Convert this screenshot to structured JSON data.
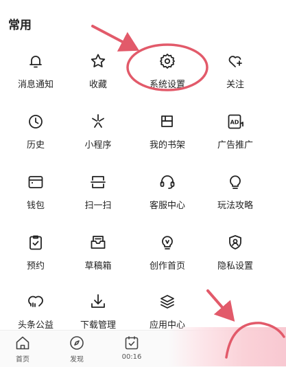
{
  "section": {
    "title": "常用"
  },
  "grid": {
    "rows": [
      [
        {
          "label": "消息通知",
          "icon": "bell-icon"
        },
        {
          "label": "收藏",
          "icon": "star-icon"
        },
        {
          "label": "系统设置",
          "icon": "gear-icon"
        },
        {
          "label": "关注",
          "icon": "heart-plus-icon"
        }
      ],
      [
        {
          "label": "历史",
          "icon": "clock-icon"
        },
        {
          "label": "小程序",
          "icon": "asterisk-icon"
        },
        {
          "label": "我的书架",
          "icon": "bookshelf-icon"
        },
        {
          "label": "广告推广",
          "icon": "ad-icon",
          "badge_text": "AD"
        }
      ],
      [
        {
          "label": "钱包",
          "icon": "wallet-icon"
        },
        {
          "label": "扫一扫",
          "icon": "scan-icon"
        },
        {
          "label": "客服中心",
          "icon": "headset-icon"
        },
        {
          "label": "玩法攻略",
          "icon": "bulb-icon"
        }
      ],
      [
        {
          "label": "预约",
          "icon": "clipboard-check-icon"
        },
        {
          "label": "草稿箱",
          "icon": "draft-box-icon"
        },
        {
          "label": "创作首页",
          "icon": "lightbulb-pen-icon"
        },
        {
          "label": "隐私设置",
          "icon": "shield-user-icon"
        }
      ],
      [
        {
          "label": "头条公益",
          "icon": "charity-heart-icon"
        },
        {
          "label": "下载管理",
          "icon": "download-icon"
        },
        {
          "label": "应用中心",
          "icon": "layers-icon"
        },
        {
          "label": "",
          "icon": ""
        }
      ]
    ]
  },
  "bottom_nav": {
    "tabs": [
      {
        "label": "首页",
        "icon": "home-icon"
      },
      {
        "label": "发现",
        "icon": "compass-icon"
      },
      {
        "label": "00:16",
        "icon": "calendar-check-icon"
      }
    ]
  },
  "annotation": {
    "color": "#e25a6a"
  },
  "colors": {
    "icon_stroke": "#222222",
    "background": "#ffffff"
  }
}
